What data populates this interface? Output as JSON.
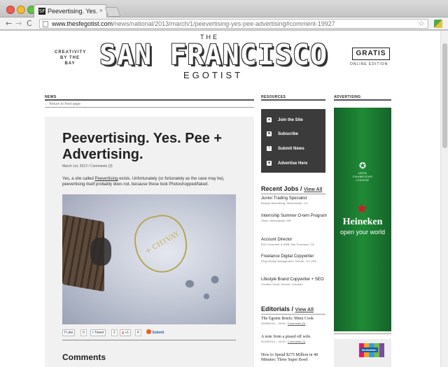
{
  "browser": {
    "tab_title": "Peevertising. Yes. Pee + A",
    "tab_favicon": "SF",
    "tab_close": "×",
    "url_domain": "www.thesfegotist.com",
    "url_path": "/news/national/2013/march/1/peevertising-yes-pee-advertising#comment-19927",
    "back_glyph": "←",
    "forward_glyph": "→",
    "reload_glyph": "C",
    "star_glyph": "☆"
  },
  "masthead": {
    "tagline": "CREATIVITY BY THE BAY",
    "the": "THE",
    "title": "SAN FRANCISCO",
    "subtitle": "EGOTIST",
    "badge": "GRATIS",
    "badge_sub": "ONLINE EDITION"
  },
  "columns": {
    "news": "NEWS",
    "resources": "RESOURCES",
    "advertising": "ADVERTISING",
    "return_link": "Return to front page"
  },
  "article": {
    "title": "Peevertising. Yes. Pee + Advertising.",
    "meta": "March 1st, 2013 / Comments (3)",
    "body_before": "Yes, a site called ",
    "body_link": "Peevertising",
    "body_after": " exists. Unfortunately (or fortunately as the case may be), peevertising itself probably does not, because these look Photoshopped/faked.",
    "photo_text": "+ CH1VAY",
    "comments_heading": "Comments"
  },
  "social": {
    "like_label": "Like",
    "like_count": "0",
    "tweet_label": "Tweet",
    "tweet_count": "2",
    "gplus_label": "+1",
    "gplus_count": "0",
    "submit_label": "Submit"
  },
  "resources": [
    {
      "label": "Join the Site",
      "icon": "person-icon",
      "glyph": "▲"
    },
    {
      "label": "Subscribe",
      "icon": "rss-icon",
      "glyph": "≋"
    },
    {
      "label": "Submit News",
      "icon": "alert-icon",
      "glyph": "!"
    },
    {
      "label": "Advertise Here",
      "icon": "speech-icon",
      "glyph": "■"
    }
  ],
  "jobs": {
    "heading": "Recent Jobs",
    "separator": " / ",
    "view_all": "View All",
    "items": [
      {
        "title": "Junior Trading Specialist",
        "meta": "Booyah Advertising, Westminster, CO"
      },
      {
        "title": "Internship Summer O-tem Program",
        "meta": "Olson, Minneapolis, MN"
      },
      {
        "title": "Account Director",
        "meta": "IDG Consumer & SMB, San Francisco, CA"
      },
      {
        "title": "Freelance Digital Copywriter",
        "meta": "Ping Identity Management, Denver, CO USA"
      },
      {
        "title": "Lifestyle Brand Copywriter + SEO",
        "meta": "Creative Scout, Denver, Colorado"
      }
    ]
  },
  "editorials": {
    "heading": "Editorials",
    "separator": " / ",
    "view_all": "View All",
    "items": [
      {
        "title": "The Egotist Briefs: Mimi Cook",
        "date": "03/08/2013 – 09:06 / ",
        "comments": "Comments (0)"
      },
      {
        "title": "A note from a pissed off wife.",
        "date": "02/25/2013 – 09:30 / ",
        "comments": "Comments (4)"
      },
      {
        "title": "How to Spend $275 Million in 48 Minutes: Three Super Bowl",
        "date": "",
        "comments": ""
      }
    ]
  },
  "ad": {
    "ucl_line1": "UEFA",
    "ucl_line2": "CHAMPIONS",
    "ucl_line3": "LEAGUE",
    "brand": "Heineken",
    "slogan": "open your world",
    "second_ad": "MediaMath"
  },
  "colors": {
    "ad_green": "#1f8a35",
    "resources_bg": "#3b3b3b",
    "heineken_star": "#d3192a"
  }
}
